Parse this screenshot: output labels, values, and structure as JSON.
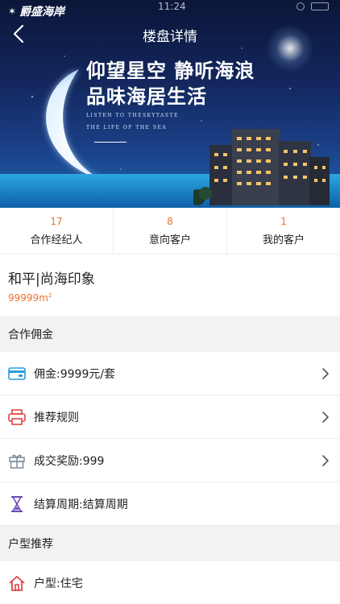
{
  "status_bar": {
    "time": "11:24"
  },
  "brand": {
    "logo_text": "爵盛海岸"
  },
  "nav": {
    "title": "楼盘详情"
  },
  "banner": {
    "headline_line1": "仰望星空  静听海浪",
    "headline_line2": "品味海居生活",
    "subtitle_line1": "LISTEN TO THESKYTASTE",
    "subtitle_line2": "THE LIFE OF THE SEA"
  },
  "stats": [
    {
      "value": "17",
      "label": "合作经纪人"
    },
    {
      "value": "8",
      "label": "意向客户"
    },
    {
      "value": "1",
      "label": "我的客户"
    }
  ],
  "project": {
    "name": "和平|尚海印象",
    "area_value": "99999",
    "area_unit": "m",
    "area_sup": "2"
  },
  "sections": {
    "commission": "合作佣金",
    "layout": "户型推荐"
  },
  "commission_rows": [
    {
      "label": "佣金:9999元/套",
      "icon": "wallet-icon",
      "color": "#2b9be0"
    },
    {
      "label": "推荐规则",
      "icon": "printer-icon",
      "color": "#e04545"
    },
    {
      "label": "成交奖励:999",
      "icon": "gift-icon",
      "color": "#7f8b9a"
    },
    {
      "label": "结算周期:结算周期",
      "icon": "hourglass-icon",
      "color": "#6a4bb5"
    }
  ],
  "layout_rows": [
    {
      "label": "户型:住宅",
      "icon": "home-icon",
      "color": "#e04545"
    }
  ]
}
